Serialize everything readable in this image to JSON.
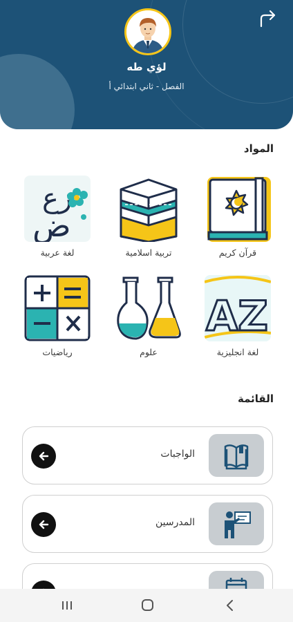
{
  "profile": {
    "name": "لؤي طه",
    "class_line": "الفصل - ثاني ابتدائي أ"
  },
  "sections": {
    "subjects_title": "المواد",
    "menu_title": "القائمة"
  },
  "subjects": [
    {
      "label": "قرآن كريم",
      "icon": "quran-icon"
    },
    {
      "label": "تربية اسلامية",
      "icon": "kaaba-icon"
    },
    {
      "label": "لغة عربية",
      "icon": "arabic-letters-icon"
    },
    {
      "label": "لغة انجليزية",
      "icon": "english-az-icon"
    },
    {
      "label": "علوم",
      "icon": "flasks-icon"
    },
    {
      "label": "رياضيات",
      "icon": "math-operators-icon"
    }
  ],
  "menu": [
    {
      "label": "الواجبات",
      "icon": "book-icon"
    },
    {
      "label": "المدرسين",
      "icon": "teacher-icon"
    },
    {
      "label": "",
      "icon": "calendar-icon"
    }
  ],
  "colors": {
    "header": "#1d5277",
    "accent_yellow": "#f5c518",
    "accent_teal": "#2bb3b1",
    "icon_box": "#c8cdd1"
  }
}
